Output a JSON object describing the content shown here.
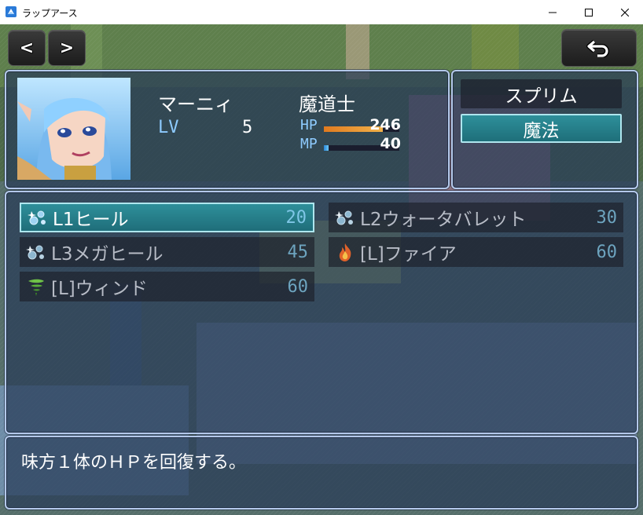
{
  "window": {
    "title": "ラップアース",
    "icon": "app-icon",
    "controls": [
      "minimize-icon",
      "maximize-icon",
      "close-icon"
    ]
  },
  "nav": {
    "prev_label": "<",
    "next_label": ">",
    "back_icon": "return-arrow-icon"
  },
  "actor": {
    "name": "マーニィ",
    "class": "魔道士",
    "level_label": "LV",
    "level": "5",
    "hp_label": "HP",
    "hp": "246",
    "hp_ratio": 0.78,
    "mp_label": "MP",
    "mp": "40",
    "mp_ratio": 0.06
  },
  "commands": [
    {
      "label": "スプリム",
      "selected": false
    },
    {
      "label": "魔法",
      "selected": true
    }
  ],
  "skills": [
    {
      "name": "L1ヒール",
      "cost": "20",
      "icon": "heal-sparkle-icon",
      "selected": true,
      "enabled": true
    },
    {
      "name": "L2ウォータバレット",
      "cost": "30",
      "icon": "heal-sparkle-icon",
      "selected": false,
      "enabled": false
    },
    {
      "name": "L3メガヒール",
      "cost": "45",
      "icon": "heal-sparkle-icon",
      "selected": false,
      "enabled": false
    },
    {
      "name": "[L]ファイア",
      "cost": "60",
      "icon": "fire-icon",
      "selected": false,
      "enabled": false
    },
    {
      "name": "[L]ウィンド",
      "cost": "60",
      "icon": "wind-icon",
      "selected": false,
      "enabled": false
    }
  ],
  "help_text": "味方１体のＨＰを回復する。",
  "colors": {
    "panel_border": "#b3c8ea",
    "selection": "#2e8f9a",
    "hp_gauge": "#e0902a",
    "mp_gauge": "#3aa6e8",
    "label_blue": "#8ecbff"
  }
}
